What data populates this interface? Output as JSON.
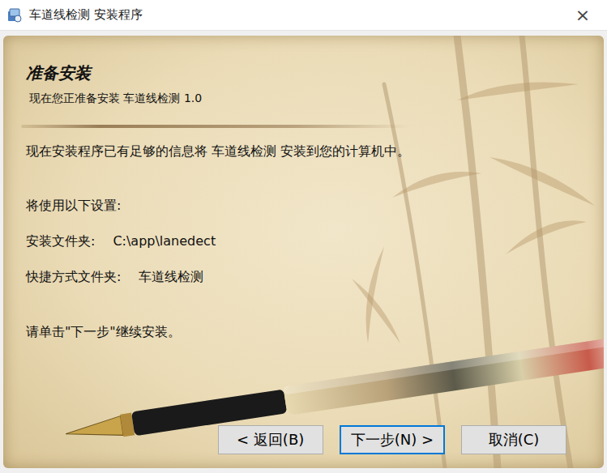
{
  "window": {
    "title": "车道线检测 安装程序",
    "close": "×"
  },
  "header": {
    "title": "准备安装",
    "subtitle": "现在您正准备安装 车道线检测 1.0"
  },
  "intro": "现在安装程序已有足够的信息将 车道线检测 安装到您的计算机中。",
  "settings_label": "将使用以下设置:",
  "settings": [
    {
      "label": "安装文件夹:",
      "value": "C:\\app\\lanedect"
    },
    {
      "label": "快捷方式文件夹:",
      "value": "车道线检测"
    }
  ],
  "instruction": "请单击\"下一步\"继续安装。",
  "buttons": [
    {
      "label": "< 返回(B)",
      "focused": false
    },
    {
      "label": "下一步(N) >",
      "focused": true
    },
    {
      "label": "取消(C)",
      "focused": false
    }
  ]
}
